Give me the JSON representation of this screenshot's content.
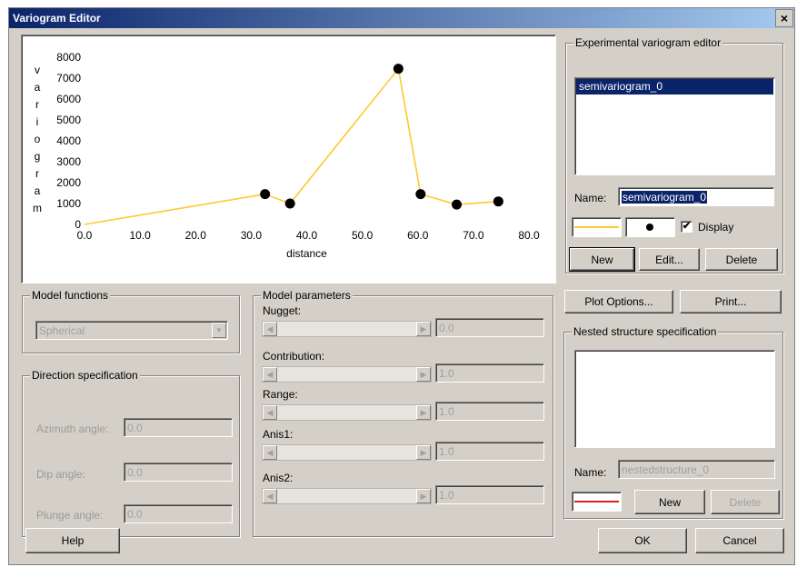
{
  "window": {
    "title": "Variogram Editor",
    "close_glyph": "×"
  },
  "chart_data": {
    "type": "line",
    "xlabel": "distance",
    "ylabel": "variogram",
    "ylabel_letters": [
      "v",
      "a",
      "r",
      "i",
      "o",
      "g",
      "r",
      "a",
      "m"
    ],
    "xlim": [
      0,
      80
    ],
    "ylim": [
      0,
      8000
    ],
    "x_ticks": [
      "0.0",
      "10.0",
      "20.0",
      "30.0",
      "40.0",
      "50.0",
      "60.0",
      "70.0",
      "80.0"
    ],
    "y_ticks": [
      "0",
      "1000",
      "2000",
      "3000",
      "4000",
      "5000",
      "6000",
      "7000",
      "8000"
    ],
    "series": [
      {
        "color": "#ffc830",
        "marker": "filled-circle",
        "points": [
          [
            0,
            0
          ],
          [
            32.5,
            1450
          ],
          [
            37.0,
            1000
          ],
          [
            56.5,
            7450
          ],
          [
            60.5,
            1450
          ],
          [
            67.0,
            950
          ],
          [
            74.5,
            1100
          ]
        ]
      }
    ],
    "grid": false
  },
  "experimental": {
    "group_title": "Experimental variogram editor",
    "list_items": [
      "semivariogram_0"
    ],
    "selected_index": 0,
    "name_label": "Name:",
    "name_value": "semivariogram_0",
    "display_label": "Display",
    "display_checked": true,
    "line_color": "#ffc830",
    "buttons": {
      "new": "New",
      "edit": "Edit...",
      "delete": "Delete"
    }
  },
  "model_functions": {
    "group_title": "Model functions",
    "selected": "Spherical"
  },
  "direction": {
    "group_title": "Direction specification",
    "azimuth_label": "Azimuth angle:",
    "azimuth_value": "0.0",
    "dip_label": "Dip angle:",
    "dip_value": "0.0",
    "plunge_label": "Plunge angle:",
    "plunge_value": "0.0"
  },
  "parameters": {
    "group_title": "Model parameters",
    "items": [
      {
        "label": "Nugget:",
        "value": "0.0"
      },
      {
        "label": "Contribution:",
        "value": "1.0"
      },
      {
        "label": "Range:",
        "value": "1.0"
      },
      {
        "label": "Anis1:",
        "value": "1.0"
      },
      {
        "label": "Anis2:",
        "value": "1.0"
      }
    ]
  },
  "plot_buttons": {
    "plot_options": "Plot Options...",
    "print": "Print..."
  },
  "nested": {
    "group_title": "Nested structure specification",
    "name_label": "Name:",
    "name_value": "nestedstructure_0",
    "line_color": "#e02020",
    "buttons": {
      "new": "New",
      "delete": "Delete"
    }
  },
  "footer": {
    "help": "Help",
    "ok": "OK",
    "cancel": "Cancel"
  }
}
